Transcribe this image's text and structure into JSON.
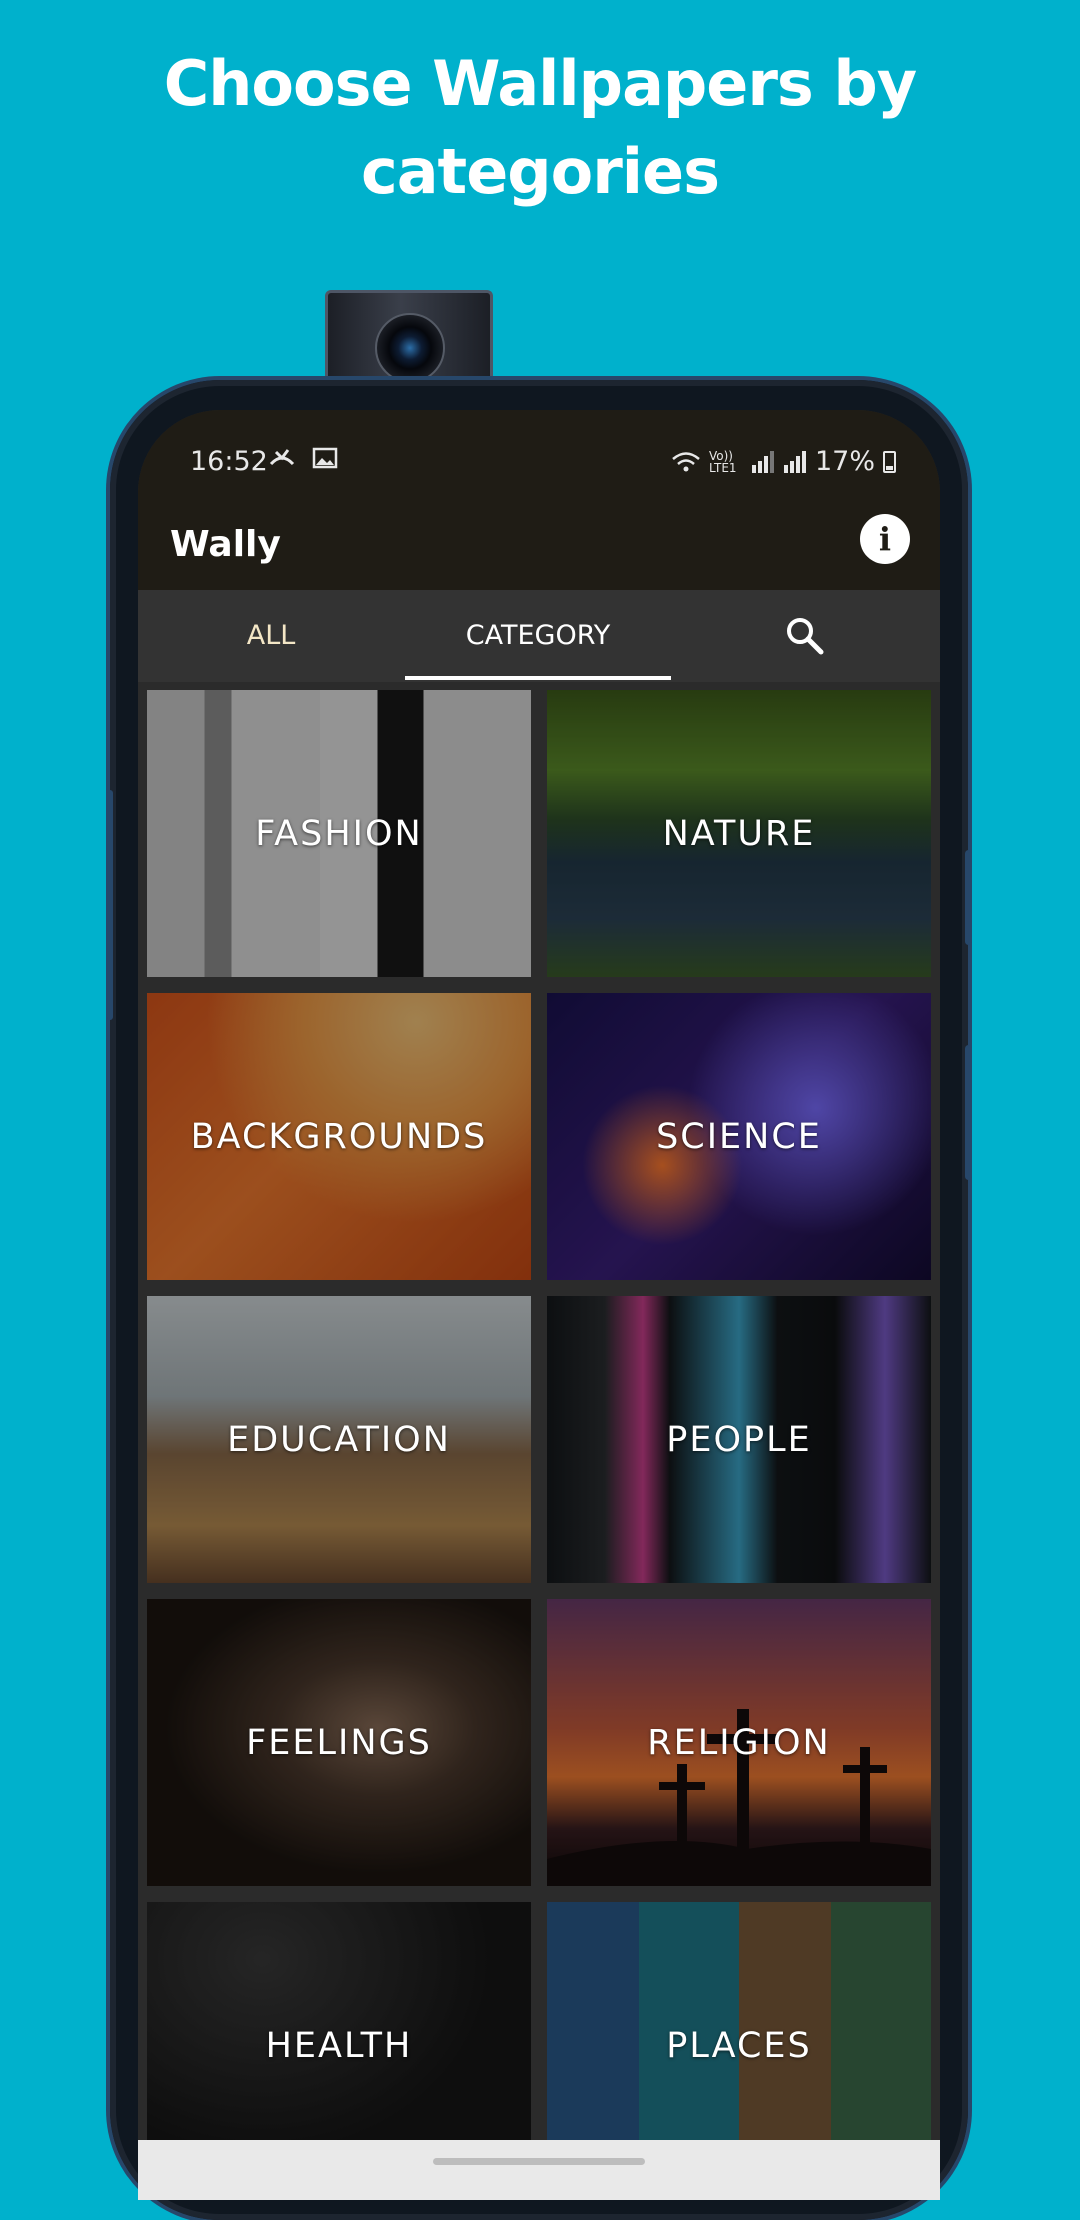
{
  "headline": {
    "line1": "Choose Wallpapers by",
    "line2": "categories"
  },
  "statusbar": {
    "time": "16:52",
    "left_icons": [
      "missed-call-icon",
      "image-icon"
    ],
    "network_label": "Vo)) LTE1",
    "battery": "17%"
  },
  "appbar": {
    "title": "Wally",
    "info_icon": "info-icon"
  },
  "tabs": [
    {
      "label": "ALL",
      "active": false
    },
    {
      "label": "CATEGORY",
      "active": true
    },
    {
      "icon": "search-icon",
      "active": false
    }
  ],
  "categories": [
    {
      "label": "FASHION"
    },
    {
      "label": "NATURE"
    },
    {
      "label": "BACKGROUNDS"
    },
    {
      "label": "SCIENCE"
    },
    {
      "label": "EDUCATION"
    },
    {
      "label": "PEOPLE"
    },
    {
      "label": "FEELINGS"
    },
    {
      "label": "RELIGION"
    },
    {
      "label": "HEALTH"
    },
    {
      "label": "PLACES"
    }
  ],
  "colors": {
    "page_background": "#00B1CC",
    "appbar": "#1F1C15",
    "tabbar": "#333333",
    "tab_inactive_text": "#F3E6C6",
    "tab_active_text": "#FFFFFF"
  }
}
